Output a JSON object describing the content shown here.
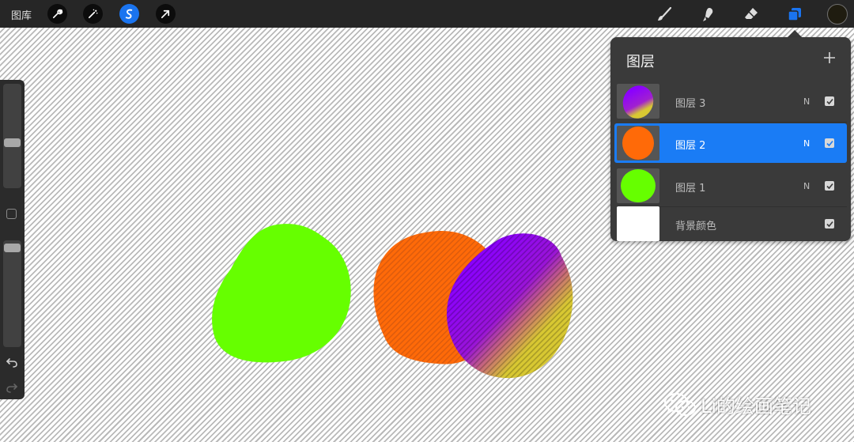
{
  "topbar": {
    "gallery_label": "图库",
    "left_tools": [
      {
        "icon": "wrench-icon",
        "active": false
      },
      {
        "icon": "magic-wand-icon",
        "active": false
      },
      {
        "icon": "selection-icon",
        "active": true
      },
      {
        "icon": "transform-arrow-icon",
        "active": false
      }
    ],
    "right_tools": [
      "brush-icon",
      "smudge-icon",
      "eraser-icon",
      "layers-icon"
    ],
    "active_color": "#1f1c10",
    "accent": "#1a74f0"
  },
  "sidebar": {
    "brush_size_level": 0.57,
    "opacity_level": 0.03
  },
  "layers_panel": {
    "title": "图层",
    "add_icon": "plus-icon",
    "layers": [
      {
        "name": "图层 3",
        "mode": "N",
        "visible": true,
        "selected": false,
        "thumb": "purple-yellow-gradient"
      },
      {
        "name": "图层 2",
        "mode": "N",
        "visible": true,
        "selected": true,
        "thumb": "orange"
      },
      {
        "name": "图层 1",
        "mode": "N",
        "visible": true,
        "selected": false,
        "thumb": "green"
      }
    ],
    "background": {
      "name": "背景颜色",
      "visible": true,
      "color": "#ffffff"
    }
  },
  "canvas_colors": {
    "green": "#66ff00",
    "orange": "#ff6a08",
    "purple": "#8a00ff",
    "yellow": "#d8c832"
  },
  "watermark": {
    "text": "Li的绘画笔记"
  }
}
